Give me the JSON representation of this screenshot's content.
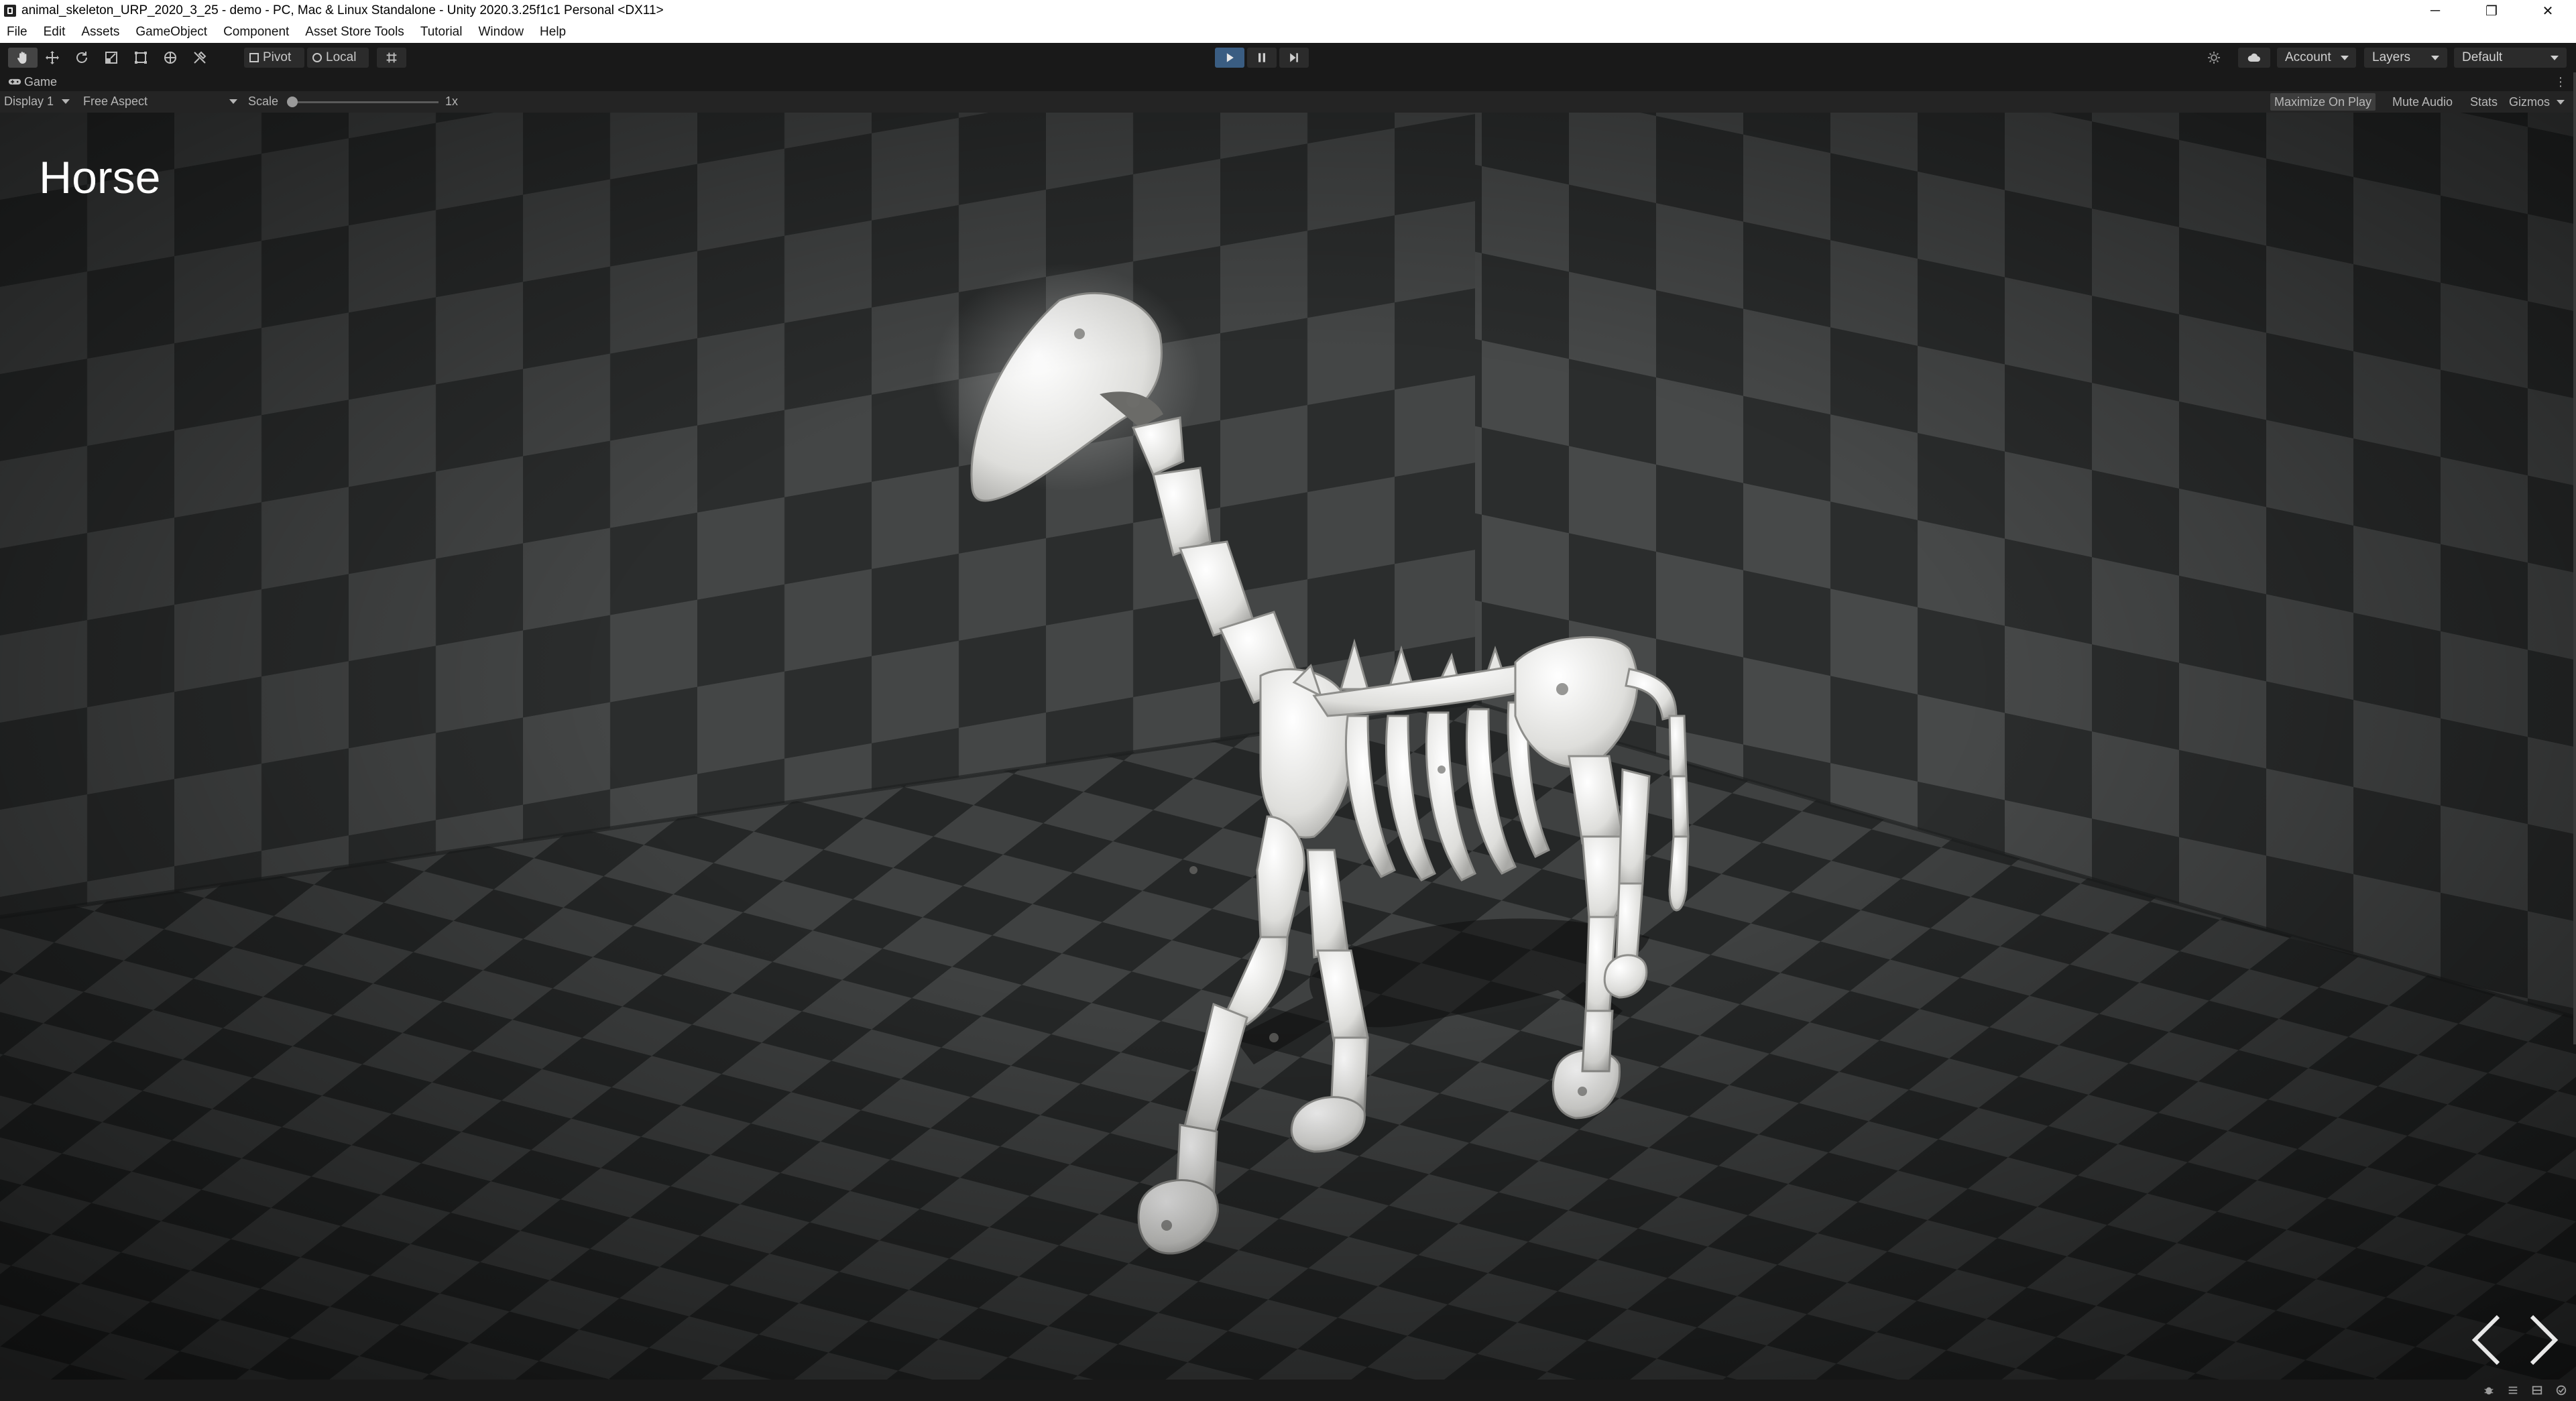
{
  "window": {
    "title": "animal_skeleton_URP_2020_3_25 - demo - PC, Mac & Linux Standalone - Unity 2020.3.25f1c1 Personal <DX11>",
    "minimize_glyph": "─",
    "maximize_glyph": "❐",
    "close_glyph": "✕"
  },
  "menu": {
    "items": [
      "File",
      "Edit",
      "Assets",
      "GameObject",
      "Component",
      "Asset Store Tools",
      "Tutorial",
      "Window",
      "Help"
    ]
  },
  "toolbar": {
    "tools": [
      "hand-icon",
      "move-icon",
      "rotate-icon",
      "scale-icon",
      "rect-tool-icon",
      "transform-icon",
      "custom-tool-icon"
    ],
    "pivot_label": "Pivot",
    "local_label": "Local",
    "account_label": "Account",
    "layers_label": "Layers",
    "layout_label": "Default",
    "playing": true
  },
  "game_tab": {
    "label": "Game",
    "menu_glyph": "⋮"
  },
  "game_controls": {
    "display_label": "Display 1",
    "aspect_label": "Free Aspect",
    "scale_label": "Scale",
    "scale_value": "1x",
    "scale_fraction": 0.0,
    "maximize_label": "Maximize On Play",
    "maximize_active": true,
    "mute_label": "Mute Audio",
    "stats_label": "Stats",
    "gizmos_label": "Gizmos"
  },
  "scene": {
    "title": "Horse",
    "prev_icon": "chevron-left-icon",
    "next_icon": "chevron-right-icon"
  },
  "colors": {
    "editor_bg": "#191919",
    "play_active": "#3a5d82",
    "floor_dark": "#2a2c2c",
    "floor_light": "#4a4c4c",
    "bone": "#e6e6e4"
  }
}
